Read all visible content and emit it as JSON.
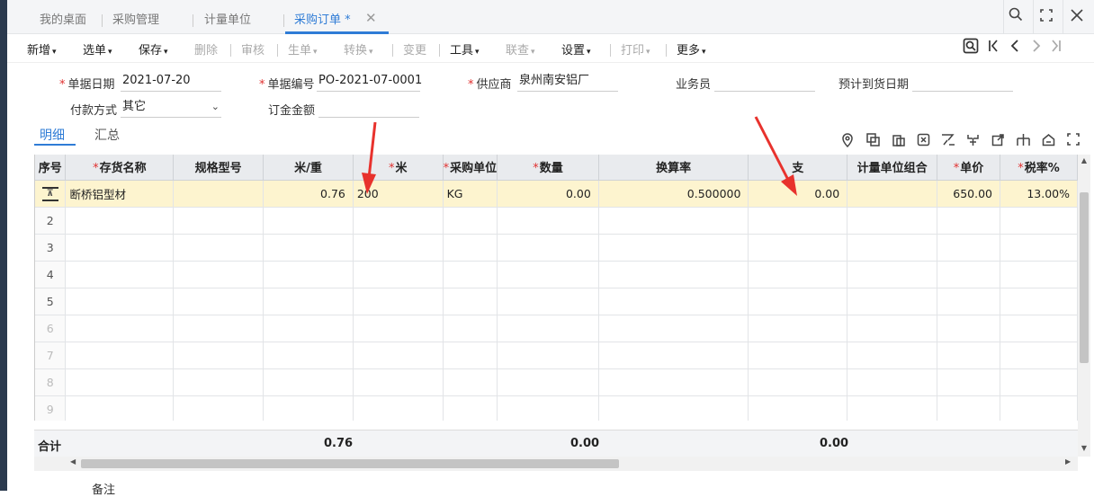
{
  "tabs": [
    {
      "label": "我的桌面"
    },
    {
      "label": "采购管理"
    },
    {
      "label": "计量单位"
    },
    {
      "label": "采购订单 *"
    }
  ],
  "window": {
    "search": "⚲",
    "expand": "⛶",
    "close": "✕"
  },
  "toolbar": {
    "add": "新增",
    "select": "选单",
    "save": "保存",
    "delete": "删除",
    "audit": "审核",
    "generate": "生单",
    "convert": "转换",
    "change": "变更",
    "tools": "工具",
    "linked": "联查",
    "settings": "设置",
    "print": "打印",
    "more": "更多"
  },
  "form": {
    "date_label": "单据日期",
    "date_value": "2021-07-20",
    "number_label": "单据编号",
    "number_value": "PO-2021-07-0001",
    "supplier_label": "供应商",
    "supplier_value": "泉州南安铝厂",
    "salesman_label": "业务员",
    "salesman_value": "",
    "eta_label": "预计到货日期",
    "eta_value": "",
    "payment_label": "付款方式",
    "payment_value": "其它",
    "deposit_label": "订金金额",
    "deposit_value": ""
  },
  "subtabs": {
    "detail": "明细",
    "summary": "汇总"
  },
  "grid": {
    "columns": [
      "序号",
      "存货名称",
      "规格型号",
      "米/重",
      "米",
      "采购单位",
      "数量",
      "换算率",
      "支",
      "计量单位组合",
      "单价",
      "税率%"
    ],
    "row1": {
      "name": "断桥铝型材",
      "spec": "",
      "mweight": "0.76",
      "meter": "200",
      "unit": "KG",
      "qty": "0.00",
      "rate": "0.500000",
      "zhi": "0.00",
      "combo": "",
      "price": "650.00",
      "tax": "13.00%"
    },
    "row_numbers": [
      "2",
      "3",
      "4",
      "5",
      "6",
      "7",
      "8",
      "9"
    ]
  },
  "totals": {
    "label": "合计",
    "mweight": "0.76",
    "qty": "0.00",
    "zhi": "0.00"
  },
  "remark_label": "备注",
  "colors": {
    "accent": "#2f7cd6",
    "required": "#e0302f",
    "selected_row": "#fdf4cf",
    "annotation_arrow": "#e8322d"
  }
}
